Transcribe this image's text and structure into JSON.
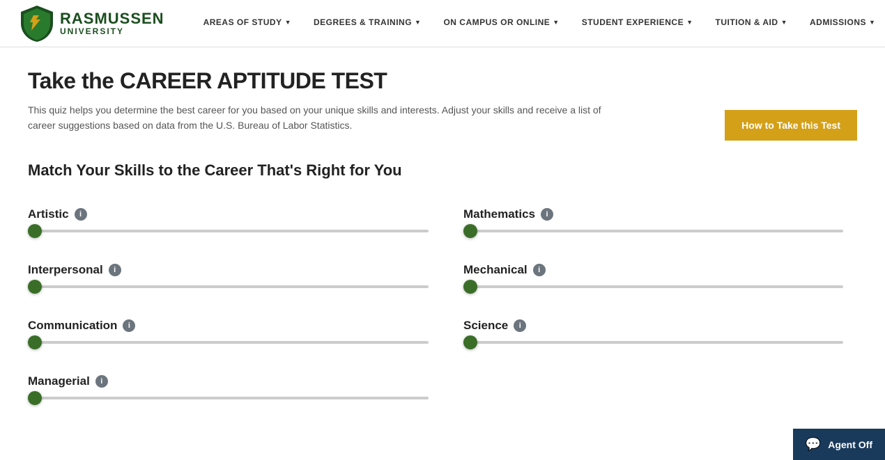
{
  "nav": {
    "logo": {
      "top": "RASMUSSEN",
      "bot": "UNIVERSITY"
    },
    "items": [
      {
        "id": "areas-of-study",
        "label": "AREAS OF STUDY",
        "hasChevron": true
      },
      {
        "id": "degrees-training",
        "label": "DEGREES & TRAINING",
        "hasChevron": true
      },
      {
        "id": "on-campus-online",
        "label": "ON CAMPUS OR ONLINE",
        "hasChevron": true
      },
      {
        "id": "student-experience",
        "label": "STUDENT EXPERIENCE",
        "hasChevron": true
      },
      {
        "id": "tuition-aid",
        "label": "TUITION & AID",
        "hasChevron": true
      },
      {
        "id": "admissions",
        "label": "ADMISSIONS",
        "hasChevron": true
      }
    ]
  },
  "page": {
    "title": "Take the CAREER APTITUDE TEST",
    "subtitle": "This quiz helps you determine the best career for you based on your unique skills and interests. Adjust your skills and receive a list of career suggestions based on data from the U.S. Bureau of Labor Statistics.",
    "how_to_btn": "How to Take this Test",
    "section_heading": "Match Your Skills to the Career That's Right for You",
    "sliders": [
      {
        "id": "artistic",
        "label": "Artistic",
        "value": 1
      },
      {
        "id": "mathematics",
        "label": "Mathematics",
        "value": 1
      },
      {
        "id": "interpersonal",
        "label": "Interpersonal",
        "value": 1
      },
      {
        "id": "mechanical",
        "label": "Mechanical",
        "value": 1
      },
      {
        "id": "communication",
        "label": "Communication",
        "value": 1
      },
      {
        "id": "science",
        "label": "Science",
        "value": 1
      },
      {
        "id": "managerial",
        "label": "Managerial",
        "value": 1
      }
    ]
  },
  "chat": {
    "label": "Agent Off"
  }
}
